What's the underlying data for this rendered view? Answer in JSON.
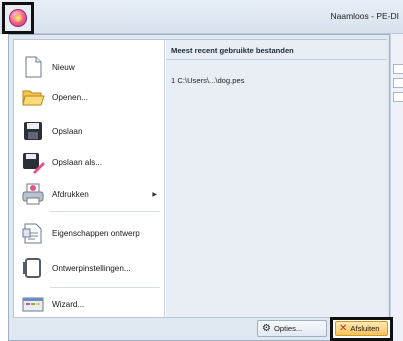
{
  "window": {
    "title": "Naamloos - PE-DI"
  },
  "menu": {
    "items": [
      {
        "label": "Nieuw",
        "icon": "new-document-icon"
      },
      {
        "label": "Openen...",
        "icon": "open-folder-icon"
      },
      {
        "label": "Opslaan",
        "icon": "save-icon"
      },
      {
        "label": "Opslaan als...",
        "icon": "save-as-icon"
      },
      {
        "label": "Afdrukken",
        "icon": "print-icon",
        "has_submenu": true
      },
      {
        "label": "Eigenschappen ontwerp",
        "icon": "design-properties-icon"
      },
      {
        "label": "Ontwerpinstellingen...",
        "icon": "design-settings-icon"
      },
      {
        "label": "Wizard...",
        "icon": "wizard-icon"
      }
    ],
    "recent": {
      "header": "Meest recent gebruikte bestanden",
      "files": [
        {
          "index": "1",
          "path": "C:\\Users\\...\\dog.pes"
        }
      ]
    },
    "footer": {
      "options_label": "Opties...",
      "exit_label": "Afsluiten"
    }
  },
  "colors": {
    "accent_pink": "#e8528c",
    "exit_button": "#f7c25a",
    "menu_bg": "#dfe7f1"
  }
}
